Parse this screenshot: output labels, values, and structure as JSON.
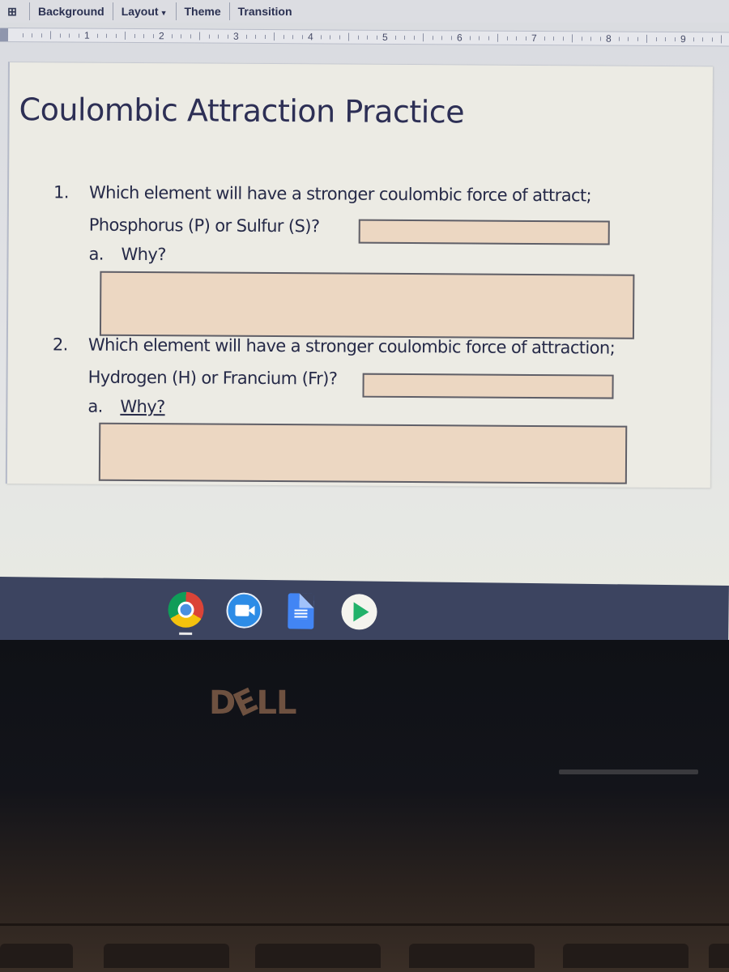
{
  "app": {
    "toolbar": {
      "items": [
        {
          "label": "Background"
        },
        {
          "label": "Layout",
          "has_dropdown": true
        },
        {
          "label": "Theme"
        },
        {
          "label": "Transition"
        }
      ],
      "new_slide_icon": "add-slide-icon"
    },
    "ruler": {
      "labels": [
        "1",
        "2",
        "3",
        "4",
        "5",
        "6",
        "7",
        "8",
        "9"
      ]
    }
  },
  "slide": {
    "title": "Coulombic Attraction Practice",
    "questions": [
      {
        "number": "1.",
        "line1": "Which element will have a stronger coulombic force of attract;",
        "line2": "Phosphorus (P) or Sulfur (S)?",
        "answer_value": "",
        "sub_label": "a.",
        "sub_text": "Why?",
        "why_value": ""
      },
      {
        "number": "2.",
        "line1": "Which element will have a stronger coulombic force of attraction;",
        "line2": "Hydrogen (H) or Francium (Fr)?",
        "answer_value": "",
        "sub_label": "a.",
        "sub_text": "Why?",
        "why_value": ""
      }
    ],
    "answer_box_color": "#ecd7c2"
  },
  "shelf": {
    "apps": [
      {
        "name": "Chrome",
        "icon": "chrome-icon",
        "active": true
      },
      {
        "name": "Google Meet",
        "icon": "meet-icon"
      },
      {
        "name": "Google Docs",
        "icon": "docs-icon"
      },
      {
        "name": "Google Play Store",
        "icon": "play-store-icon"
      }
    ]
  },
  "hardware": {
    "brand_logo": "DELL"
  }
}
